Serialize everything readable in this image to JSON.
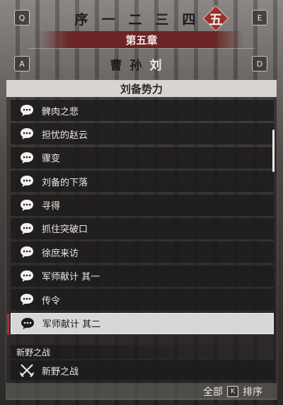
{
  "keys": {
    "prev_chapter": "Q",
    "next_chapter": "E",
    "prev_faction": "A",
    "next_faction": "D",
    "sort": "K"
  },
  "chapters": {
    "tabs": [
      "序",
      "一",
      "二",
      "三",
      "四",
      "五"
    ],
    "active_index": 5,
    "current_title": "第五章"
  },
  "factions": {
    "tabs": [
      "曹",
      "孙",
      "刘"
    ],
    "active_index": 2
  },
  "panel": {
    "title": "刘备势力",
    "items": [
      {
        "label": "髀肉之悲"
      },
      {
        "label": "担忧的赵云"
      },
      {
        "label": "骤变"
      },
      {
        "label": "刘备的下落"
      },
      {
        "label": "寻得"
      },
      {
        "label": "抓住突破口"
      },
      {
        "label": "徐庶来访"
      },
      {
        "label": "军师献计 其一"
      },
      {
        "label": "传令"
      },
      {
        "label": "军师献计 其二"
      }
    ],
    "selected_index": 9,
    "section": {
      "label": "新野之战",
      "battle_label": "新野之战"
    },
    "footer": {
      "filter_label": "全部",
      "sort_label": "排序"
    }
  },
  "colors": {
    "accent_red": "#9b2f2f",
    "selected_bg": "#d9d7d5",
    "row_bg": "#1c1b1b"
  },
  "icons": {
    "dialogue": "speech-bubble-icon",
    "battle": "crossed-swords-icon"
  }
}
